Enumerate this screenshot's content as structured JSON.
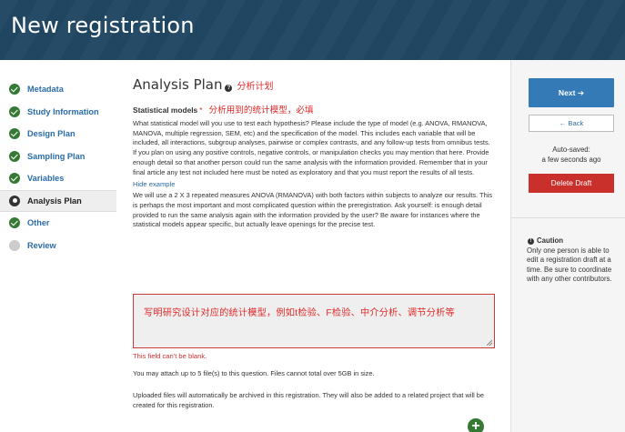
{
  "page": {
    "title": "New registration"
  },
  "sidebar": {
    "items": [
      {
        "label": "Metadata",
        "state": "done"
      },
      {
        "label": "Study Information",
        "state": "done"
      },
      {
        "label": "Design Plan",
        "state": "done"
      },
      {
        "label": "Sampling Plan",
        "state": "done"
      },
      {
        "label": "Variables",
        "state": "done"
      },
      {
        "label": "Analysis Plan",
        "state": "current"
      },
      {
        "label": "Other",
        "state": "done"
      },
      {
        "label": "Review",
        "state": "todo"
      }
    ]
  },
  "main": {
    "section_title": "Analysis Plan",
    "help_icon_glyph": "?",
    "section_annotation": "分析计划",
    "field": {
      "label": "Statistical models",
      "required_mark": "*",
      "annotation": "分析用到的统计模型，必填",
      "description": "What statistical model will you use to test each hypothesis? Please include the type of model (e.g. ANOVA, RMANOVA, MANOVA, multiple regression, SEM, etc) and the specification of the model. This includes each variable that will be included, all interactions, subgroup analyses, pairwise or complex contrasts, and any follow-up tests from omnibus tests. If you plan on using any positive controls, negative controls, or manipulation checks you may mention that here. Provide enough detail so that another person could run the same analysis with the information provided. Remember that in your final article any test not included here must be noted as exploratory and that you must report the results of all tests.",
      "hide_example_label": "Hide example",
      "example": "We will use a  2 X 3 repeated measures ANOVA (RMANOVA) with both factors within subjects to analyze our results.  This is perhaps the most important and most complicated question within the preregistration. Ask yourself: is enough detail provided to run the same analysis again with the information provided by the user? Be aware for instances where the statistical models appear specific, but actually leave openings for the precise test.",
      "answer_value": "写明研究设计对应的统计模型，例如t检验、F检验、中介分析、调节分析等",
      "error": "This field can't be blank.",
      "attach_note": "You may attach up to 5 file(s) to this question. Files cannot total over 5GB in size.",
      "archive_note": "Uploaded files will automatically be archived in this registration. They will also be added to a related project that will be created for this registration.",
      "add_glyph": "+"
    }
  },
  "right_panel": {
    "next_label": "Next ➔",
    "back_label": "← Back",
    "autosave_line1": "Auto-saved:",
    "autosave_line2": "a few seconds ago",
    "delete_label": "Delete Draft",
    "caution_glyph": "!",
    "caution_title": "Caution",
    "caution_text": "Only one person is able to edit a registration draft at a time. Be sure to coordinate with any other contributors."
  },
  "colors": {
    "header_bg": "#214762",
    "primary": "#337ab7",
    "danger": "#c9302c",
    "success": "#357935",
    "annotation_red": "#e02a2a"
  }
}
